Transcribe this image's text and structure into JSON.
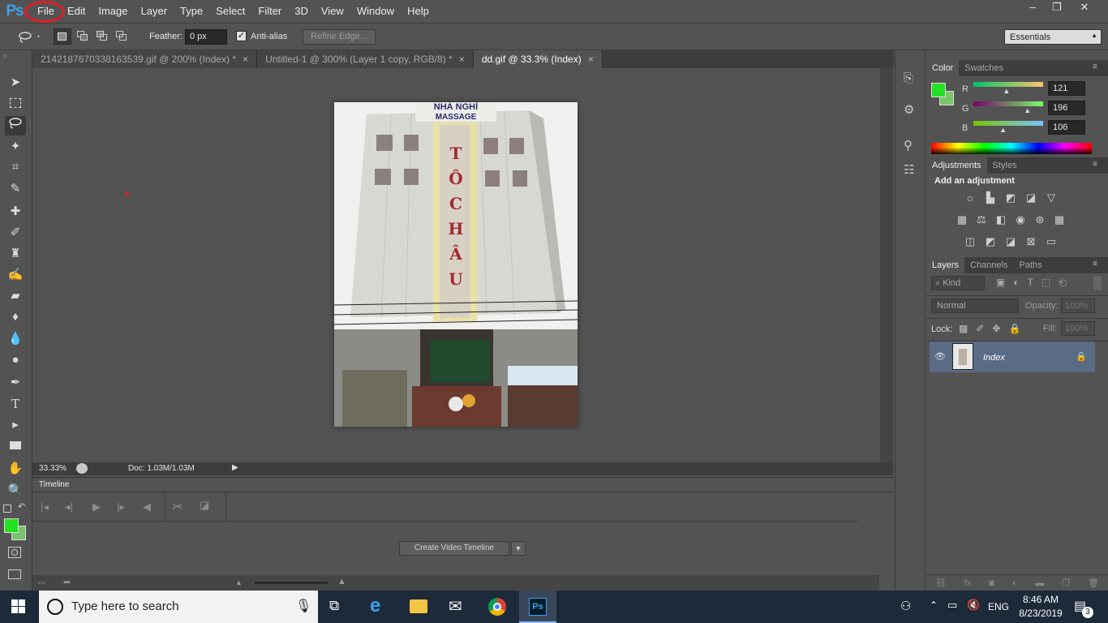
{
  "app": {
    "logo": "Ps"
  },
  "menu": [
    "File",
    "Edit",
    "Image",
    "Layer",
    "Type",
    "Select",
    "Filter",
    "3D",
    "View",
    "Window",
    "Help"
  ],
  "window_controls": {
    "minimize": "–",
    "restore": "❐",
    "close": "✕"
  },
  "options": {
    "feather_label": "Feather:",
    "feather_value": "0 px",
    "antialias_label": "Anti-alias",
    "refine_edge": "Refine Edge...",
    "workspace": "Essentials"
  },
  "tabs": [
    {
      "label": "2142187670338163539.gif @ 200% (Index) *",
      "active": false
    },
    {
      "label": "Untitled-1 @ 300% (Layer 1 copy, RGB/8) *",
      "active": false
    },
    {
      "label": "dd.gif @ 33.3% (Index)",
      "active": true
    }
  ],
  "image": {
    "sign_top": "NHÀ NGHỈ",
    "sign_sub": "MASSAGE",
    "vertical_letters": [
      "T",
      "Ô",
      "C",
      "H",
      "Â",
      "U"
    ]
  },
  "status": {
    "zoom": "33.33%",
    "doc": "Doc: 1.03M/1.03M"
  },
  "timeline": {
    "title": "Timeline",
    "create_button": "Create Video Timeline"
  },
  "color_panel": {
    "tabs": [
      "Color",
      "Swatches"
    ],
    "r_label": "R",
    "g_label": "G",
    "b_label": "B",
    "r": "121",
    "g": "196",
    "b": "106",
    "r_frac": 0.47,
    "g_frac": 0.77,
    "b_frac": 0.42,
    "foreground": "#22e022",
    "background": "#79c46a"
  },
  "adjustments_panel": {
    "tabs": [
      "Adjustments",
      "Styles"
    ],
    "heading": "Add an adjustment"
  },
  "layers_panel": {
    "tabs": [
      "Layers",
      "Channels",
      "Paths"
    ],
    "filter_kind": "Kind",
    "blend_mode": "Normal",
    "opacity_label": "Opacity:",
    "opacity_value": "100%",
    "lock_label": "Lock:",
    "fill_label": "Fill:",
    "fill_value": "100%",
    "layer_name": "Index"
  },
  "taskbar": {
    "search_placeholder": "Type here to search",
    "lang": "ENG",
    "time": "8:46 AM",
    "date": "8/23/2019",
    "notifications": "3"
  },
  "colors": {
    "accent_red": "#e01e25",
    "ps_blue": "#3ea0ee",
    "selected_layer": "#5a6b85"
  }
}
